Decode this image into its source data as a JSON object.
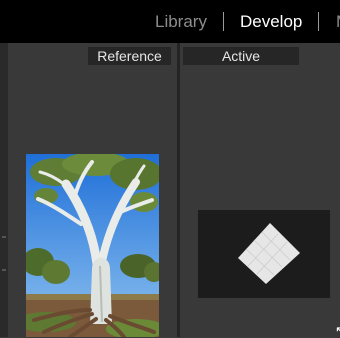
{
  "nav": {
    "modules": [
      "Library",
      "Develop",
      "M"
    ],
    "active_module": "Develop"
  },
  "compare": {
    "reference_label": "Reference",
    "active_label": "Active"
  },
  "colors": {
    "topbar": "#000000",
    "panel": "#393939",
    "label_bg": "#262626",
    "active_module_text": "#ffffff",
    "inactive_module_text": "#8d8d8d"
  }
}
